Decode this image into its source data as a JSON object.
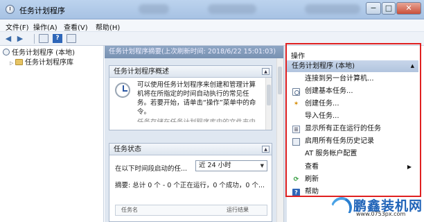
{
  "window": {
    "title": "任务计划程序",
    "minimize": "−",
    "maximize": "□",
    "close": "✕"
  },
  "menu": [
    "文件(F)",
    "操作(A)",
    "查看(V)",
    "帮助(H)"
  ],
  "tree": {
    "root": "任务计划程序 (本地)",
    "child": "任务计划程序库"
  },
  "center": {
    "header": "任务计划程序摘要(上次刷新时间: 2018/6/22 15:01:03)",
    "overview": {
      "title": "任务计划程序概述",
      "text": "可以使用任务计划程序来创建和管理计算机将在所指定的时间自动执行的常见任务。若要开始，请单击“操作”菜单中的命令。",
      "cut_text": "任务存储在任务计划程序库中的文件夹中"
    },
    "status": {
      "title": "任务状态",
      "filter_label": "在以下时间段启动的任...",
      "filter_value": "近 24 小时",
      "summary": "摘要: 总计 0 个 - 0 个正在运行，0 个成功，0 个...",
      "table_col1": "任务名",
      "table_col2": "运行结果"
    }
  },
  "actions": {
    "title": "操作",
    "section": "任务计划程序 (本地)",
    "items": [
      {
        "label": "连接到另一台计算机...",
        "icon": "none"
      },
      {
        "label": "创建基本任务...",
        "icon": "task-icon"
      },
      {
        "label": "创建任务...",
        "icon": "spark-icon"
      },
      {
        "label": "导入任务...",
        "icon": "none"
      },
      {
        "label": "显示所有正在运行的任务",
        "icon": "list-icon"
      },
      {
        "label": "启用所有任务历史记录",
        "icon": "history-icon"
      },
      {
        "label": "AT 服务帐户配置",
        "icon": "none"
      },
      {
        "label": "查看",
        "icon": "none"
      },
      {
        "label": "刷新",
        "icon": "refresh-icon"
      },
      {
        "label": "帮助",
        "icon": "help-icon"
      }
    ]
  },
  "watermark": {
    "name": "鹏鑫装机网",
    "url": "www.0753px.com"
  },
  "colors": {
    "highlight_border": "#e02020",
    "watermark_blue": "#1f63b8"
  }
}
